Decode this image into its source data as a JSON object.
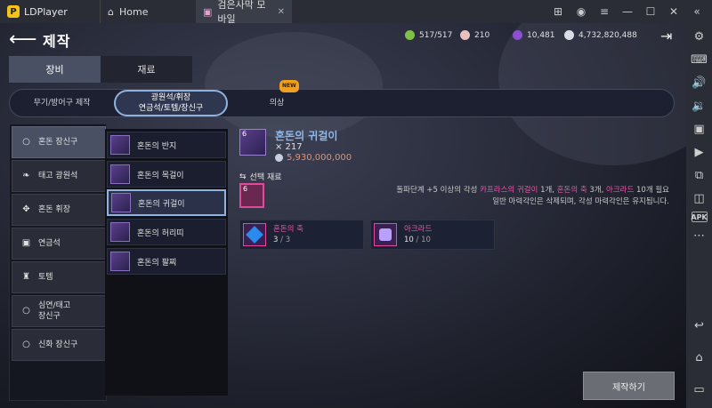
{
  "titlebar": {
    "app_name": "LDPlayer",
    "home_tab": "Home",
    "game_tab": "검은사막 모바일",
    "close_glyph": "✕"
  },
  "header": {
    "title": "제작"
  },
  "currency": [
    {
      "value": "517/517",
      "color": "#7fbf4a"
    },
    {
      "value": "210",
      "color": "#e8c0c0"
    },
    {
      "value": "10,481",
      "color": "#8a50d0"
    },
    {
      "value": "4,732,820,488",
      "color": "#d8dde8"
    }
  ],
  "tabs": [
    {
      "label": "장비"
    },
    {
      "label": "재료"
    }
  ],
  "subtabs": [
    {
      "label": "무기/방어구 제작"
    },
    {
      "label": "광원석/휘장\n연금석/토템/장신구"
    },
    {
      "label": "의상"
    }
  ],
  "new_badge": "NEW",
  "categories": [
    {
      "label": "혼돈 장신구",
      "icon": "ring-icon"
    },
    {
      "label": "태고 광원석",
      "icon": "feather-icon"
    },
    {
      "label": "혼돈 휘장",
      "icon": "emblem-icon"
    },
    {
      "label": "연금석",
      "icon": "stone-icon"
    },
    {
      "label": "토템",
      "icon": "totem-icon"
    },
    {
      "label": "심연/태고\n장신구",
      "icon": "ring-icon"
    },
    {
      "label": "신화 장신구",
      "icon": "ring-icon"
    }
  ],
  "items": [
    {
      "label": "혼돈의 반지"
    },
    {
      "label": "혼돈의 목걸이"
    },
    {
      "label": "혼돈의 귀걸이"
    },
    {
      "label": "혼돈의 허리띠"
    },
    {
      "label": "혼돈의 팔찌"
    }
  ],
  "detail": {
    "level": "6",
    "name": "혼돈의 귀걸이",
    "count": "⨯ 217",
    "price": "5,930,000,000",
    "select_label": "선택 재료",
    "select_level": "6",
    "desc_line1_a": "돌파단계 +5 이상의 각성",
    "desc_line1_b": "카프라스의 귀걸이",
    "desc_line1_c": "1개,",
    "desc_line1_d": "혼돈의 축",
    "desc_line1_e": "3개,",
    "desc_line1_f": "아크라드",
    "desc_line1_g": "10개 필요",
    "desc_line2": "일반 마력각인은 삭제되며, 각성 마력각인은 유지됩니다."
  },
  "materials": [
    {
      "name": "혼돈의 축",
      "have": "3",
      "need": "3"
    },
    {
      "name": "아크라드",
      "have": "10",
      "need": "10"
    }
  ],
  "qty_separator": " / ",
  "craft_button": "제작하기"
}
